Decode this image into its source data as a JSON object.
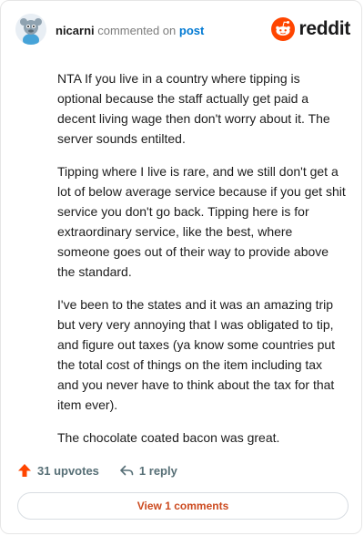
{
  "header": {
    "username": "nicarni",
    "action_text": "commented on",
    "post_link": "post",
    "brand": "reddit"
  },
  "comment": {
    "paragraphs": [
      "NTA If you live in a country where tipping is optional because the staff actually get paid a decent living wage then don't worry about it. The server sounds entilted.",
      "Tipping where I live is rare, and we still don't get a lot of below average service because if you get shit service you don't go back. Tipping here is for extraordinary service, like the best, where someone goes out of their way to provide above the standard.",
      "I've been to the states and it was an amazing trip but very very annoying that I was obligated to tip, and figure out taxes (ya know some countries put the total cost of things on the item including tax and you never have to think about the tax for that item ever).",
      "The chocolate coated bacon was great."
    ]
  },
  "actions": {
    "upvotes": "31 upvotes",
    "reply": "1 reply"
  },
  "footer": {
    "view_comments": "View 1 comments"
  },
  "colors": {
    "accent": "#ff4500",
    "link": "#0079d3",
    "view_text": "#cc4a1f"
  }
}
